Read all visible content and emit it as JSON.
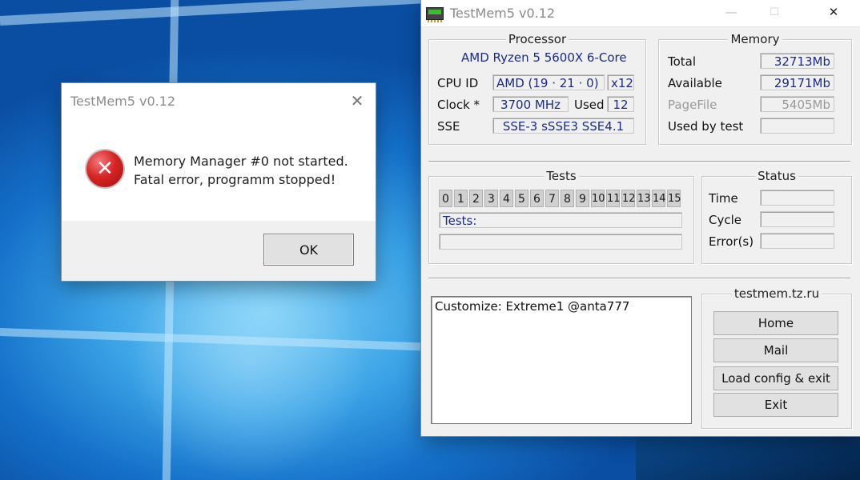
{
  "dialog": {
    "title": "TestMem5 v0.12",
    "close_glyph": "✕",
    "message_line1": "Memory Manager #0 not started.",
    "message_line2": "Fatal error, programm stopped!",
    "ok_label": "OK",
    "icon": "error-icon",
    "icon_glyph": "✕"
  },
  "app": {
    "title": "TestMem5 v0.12",
    "controls": {
      "minimize": "—",
      "maximize": "☐",
      "close": "✕"
    },
    "processor": {
      "group_title": "Processor",
      "name": "AMD Ryzen 5 5600X 6-Core",
      "cpu_id_label": "CPU ID",
      "cpu_id_value": "AMD  (19 · 21 · 0)",
      "threads_value": "x12",
      "clock_label": "Clock *",
      "clock_value": "3700 MHz",
      "used_label": "Used",
      "used_value": "12",
      "sse_label": "SSE",
      "sse_value": "SSE-3 sSSE3 SSE4.1"
    },
    "memory": {
      "group_title": "Memory",
      "total_label": "Total",
      "total_value": "32713Mb",
      "available_label": "Available",
      "available_value": "29171Mb",
      "pagefile_label": "PageFile",
      "pagefile_value": "5405Mb",
      "used_by_test_label": "Used by test",
      "used_by_test_value": ""
    },
    "tests": {
      "group_title": "Tests",
      "numbers": [
        "0",
        "1",
        "2",
        "3",
        "4",
        "5",
        "6",
        "7",
        "8",
        "9",
        "10",
        "11",
        "12",
        "13",
        "14",
        "15"
      ],
      "tests_label": "Tests:",
      "progress_value": ""
    },
    "status": {
      "group_title": "Status",
      "time_label": "Time",
      "cycle_label": "Cycle",
      "errors_label": "Error(s)",
      "time_value": "",
      "cycle_value": "",
      "errors_value": ""
    },
    "log_text": "Customize: Extreme1 @anta777",
    "links": {
      "group_title": "testmem.tz.ru",
      "home_label": "Home",
      "mail_label": "Mail",
      "load_config_label": "Load config & exit",
      "exit_label": "Exit"
    }
  }
}
